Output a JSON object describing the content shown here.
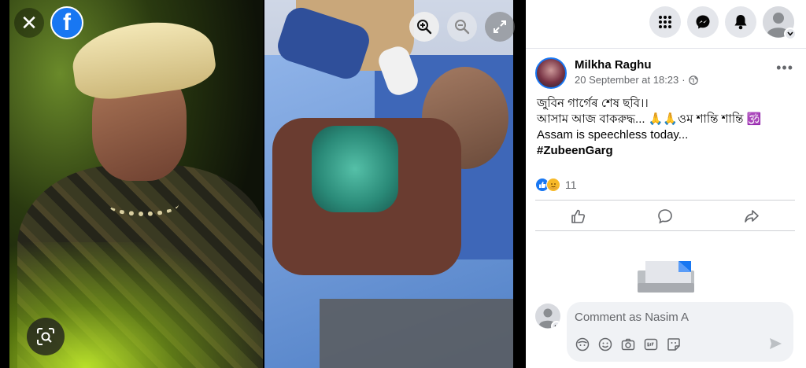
{
  "viewer": {
    "close_glyph": "✕",
    "logo_letter": "f"
  },
  "post": {
    "author_name": "Milkha Raghu",
    "timestamp": "20 September at 18:23",
    "privacy_icon": "globe-icon",
    "more_glyph": "•••",
    "text_lines": [
      "জুবিন গাৰ্গেৰ শেষ ছবি।।",
      "আসাম আজ বাকরুদ্ধ... 🙏🙏ওম শান্তি শান্তি 🕉️",
      "Assam is speechless today..."
    ],
    "hashtag": "#ZubeenGarg",
    "reaction_count": "11"
  },
  "comment": {
    "placeholder": "Comment as Nasim A"
  },
  "colors": {
    "brand": "#1877f2",
    "panel_bg": "#ffffff",
    "comment_bg": "#f0f2f5"
  }
}
